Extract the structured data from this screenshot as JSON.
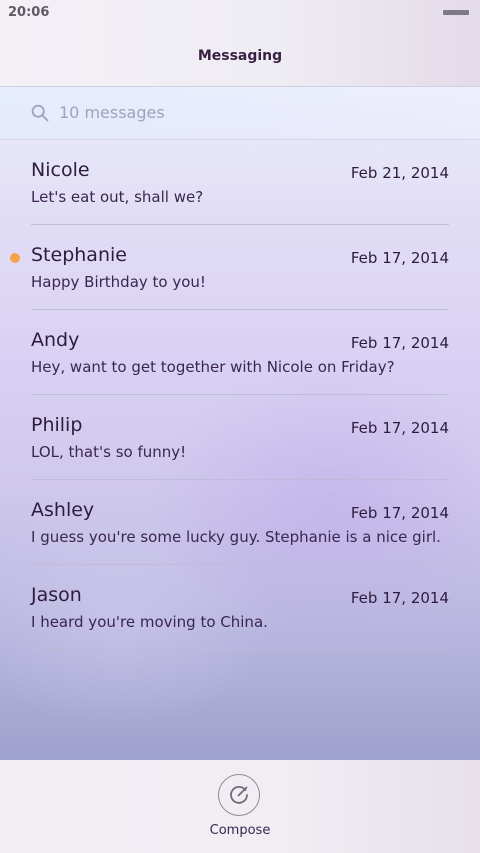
{
  "status_bar": {
    "time": "20:06",
    "battery_icon": "battery-icon"
  },
  "header": {
    "title": "Messaging"
  },
  "search": {
    "icon": "search-icon",
    "placeholder": "10 messages"
  },
  "messages": [
    {
      "name": "Nicole",
      "date": "Feb 21, 2014",
      "preview": "Let's eat out, shall we?",
      "unread": false
    },
    {
      "name": "Stephanie",
      "date": "Feb 17, 2014",
      "preview": "Happy Birthday to you!",
      "unread": true
    },
    {
      "name": "Andy",
      "date": "Feb 17, 2014",
      "preview": "Hey, want to get together with Nicole on Friday?",
      "unread": false
    },
    {
      "name": "Philip",
      "date": "Feb 17, 2014",
      "preview": "LOL, that's so funny!",
      "unread": false
    },
    {
      "name": "Ashley",
      "date": "Feb 17, 2014",
      "preview": "I guess you're some lucky guy. Stephanie is a nice girl.",
      "unread": false
    },
    {
      "name": "Jason",
      "date": "Feb 17, 2014",
      "preview": "I heard you're moving to China.",
      "unread": false
    }
  ],
  "footer": {
    "compose_label": "Compose",
    "compose_icon": "compose-icon"
  },
  "colors": {
    "unread_dot": "#f5a34a",
    "title_text": "#3a1f45",
    "body_text": "#2e1c3e"
  }
}
